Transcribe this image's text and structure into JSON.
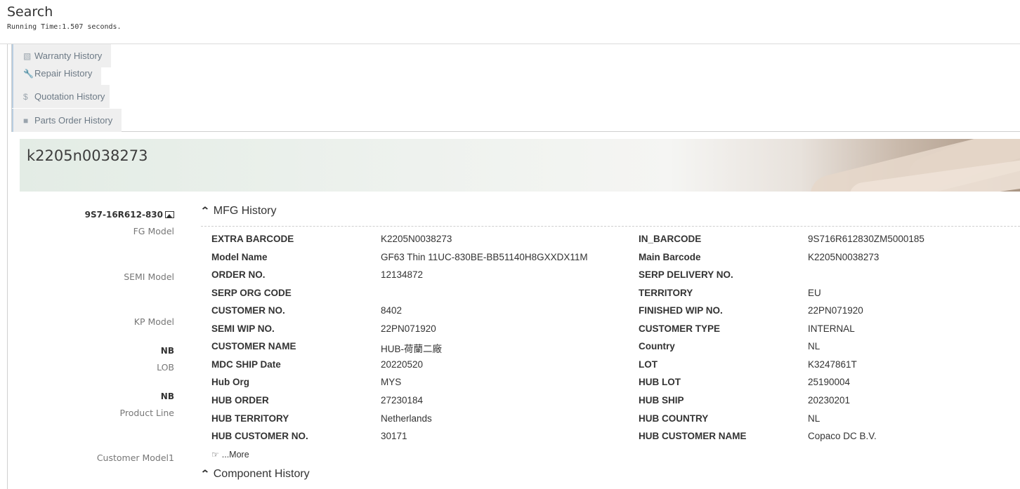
{
  "header": {
    "title": "Search",
    "running_time": "Running Time:1.507 seconds."
  },
  "tabs": [
    {
      "label": "Warranty History",
      "icon": "book-icon"
    },
    {
      "label": "Repair History",
      "icon": "wrench-icon"
    },
    {
      "label": "Quotation History",
      "icon": "dollar-icon"
    },
    {
      "label": "Parts Order History",
      "icon": "truck-icon"
    }
  ],
  "banner": {
    "title": "k2205n0038273"
  },
  "sidebar": {
    "fg_model_value": "9S7-16R612-830",
    "fg_model_label": "FG Model",
    "semi_model_label": "SEMI Model",
    "kp_model_label": "KP Model",
    "lob_value": "NB",
    "lob_label": "LOB",
    "product_line_value": "NB",
    "product_line_label": "Product Line",
    "customer_model1_label": "Customer Model1"
  },
  "mfg": {
    "title": "MFG History",
    "rows": [
      {
        "k1": "EXTRA BARCODE",
        "v1": "K2205N0038273",
        "k2": "IN_BARCODE",
        "v2": "9S716R612830ZM5000185"
      },
      {
        "k1": "Model Name",
        "v1": "GF63 Thin 11UC-830BE-BB51140H8GXXDX11M",
        "k2": "Main Barcode",
        "v2": "K2205N0038273"
      },
      {
        "k1": "ORDER NO.",
        "v1": "12134872",
        "k2": "SERP DELIVERY NO.",
        "v2": ""
      },
      {
        "k1": "SERP ORG CODE",
        "v1": "",
        "k2": "TERRITORY",
        "v2": "EU"
      },
      {
        "k1": "CUSTOMER NO.",
        "v1": "8402",
        "k2": "FINISHED WIP NO.",
        "v2": "22PN071920"
      },
      {
        "k1": "SEMI WIP NO.",
        "v1": "22PN071920",
        "k2": "CUSTOMER TYPE",
        "v2": "INTERNAL"
      },
      {
        "k1": "CUSTOMER NAME",
        "v1": "HUB-荷蘭二廠",
        "k2": "Country",
        "v2": "NL"
      },
      {
        "k1": "MDC SHIP Date",
        "v1": "20220520",
        "k2": "LOT",
        "v2": "K3247861T"
      },
      {
        "k1": "Hub Org",
        "v1": "MYS",
        "k2": "HUB LOT",
        "v2": "25190004"
      },
      {
        "k1": "HUB ORDER",
        "v1": "27230184",
        "k2": "HUB SHIP",
        "v2": "20230201"
      },
      {
        "k1": "HUB TERRITORY",
        "v1": "Netherlands",
        "k2": "HUB COUNTRY",
        "v2": "NL"
      },
      {
        "k1": "HUB CUSTOMER NO.",
        "v1": "30171",
        "k2": "HUB CUSTOMER NAME",
        "v2": "Copaco DC B.V."
      }
    ],
    "more_label": "...More"
  },
  "component": {
    "title": "Component History"
  }
}
